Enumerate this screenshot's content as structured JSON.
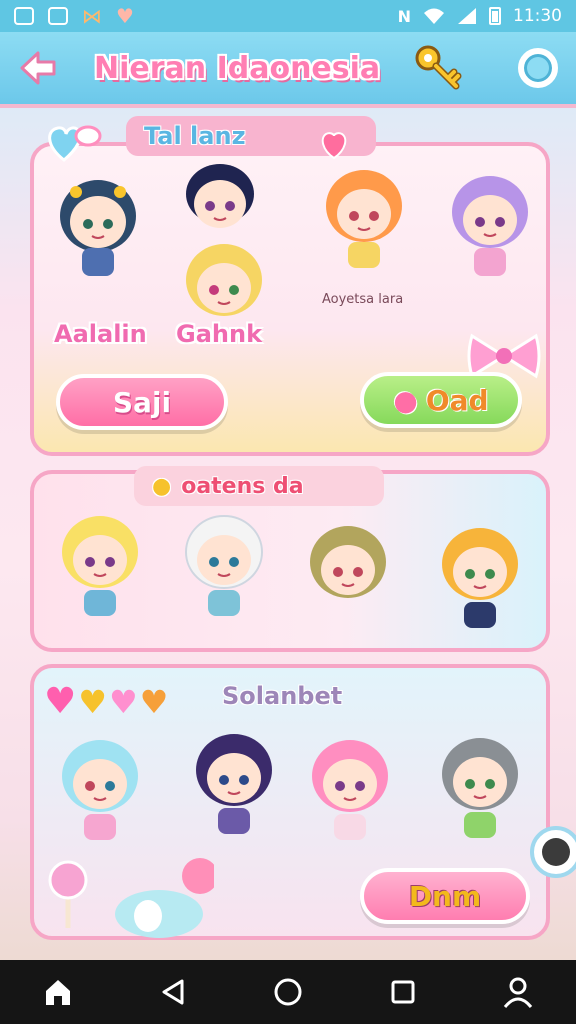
{
  "status_bar": {
    "time": "11:30",
    "notification_icons": [
      "image-icon",
      "chat-icon",
      "bow-icon",
      "heart-icon"
    ],
    "system_icons": [
      "nfc-icon",
      "wifi-icon",
      "signal-icon",
      "battery-icon"
    ]
  },
  "header": {
    "title": "Nieran Idaonesia",
    "back_icon": "arrow-left-icon",
    "key_icon": "key-icon",
    "settings_icon": "ring-icon"
  },
  "panels": [
    {
      "tab_label": "Tal lanz",
      "character_names": [
        "Aalalin",
        "Gahnk"
      ],
      "small_caption": "Aoyetsa lara",
      "buttons": [
        {
          "label": "Saji"
        },
        {
          "label": "Oad"
        }
      ]
    },
    {
      "tab_label": "oatens da"
    },
    {
      "tab_label": "Solanbet",
      "buttons": [
        {
          "label": "Dnm"
        }
      ]
    }
  ],
  "nav_bar": {
    "items": [
      "home-icon",
      "back-triangle-icon",
      "circle-home-icon",
      "recents-square-icon",
      "profile-icon"
    ]
  },
  "colors": {
    "header_bg": "#6cc8ea",
    "title_pink": "#ff7eb3",
    "panel_border": "#f6a6c6",
    "button_pink": "#ff6ea6",
    "button_green": "#86d95b"
  }
}
